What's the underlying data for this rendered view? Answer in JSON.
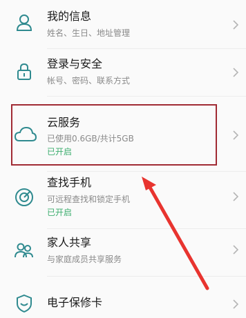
{
  "items": [
    {
      "title": "我的信息",
      "subtitle": "姓名、生日、地址管理",
      "icon": "person-icon"
    },
    {
      "title": "登录与安全",
      "subtitle": "帐号、密码、联系方式",
      "icon": "lock-icon"
    },
    {
      "title": "云服务",
      "subtitle": "已使用0.6GB/共计5GB",
      "status": "已开启",
      "icon": "cloud-icon"
    },
    {
      "title": "查找手机",
      "subtitle": "可远程查找和锁定手机",
      "status": "已开启",
      "icon": "find-phone-icon"
    },
    {
      "title": "家人共享",
      "subtitle": "与家庭成员共享服务",
      "icon": "family-share-icon"
    },
    {
      "title": "电子保修卡",
      "icon": "warranty-shield-icon"
    }
  ],
  "colors": {
    "accent_green": "#3dae6f",
    "icon_teal": "#2f8a8f",
    "highlight_border": "#a02a33",
    "arrow_red": "#e8342f"
  }
}
